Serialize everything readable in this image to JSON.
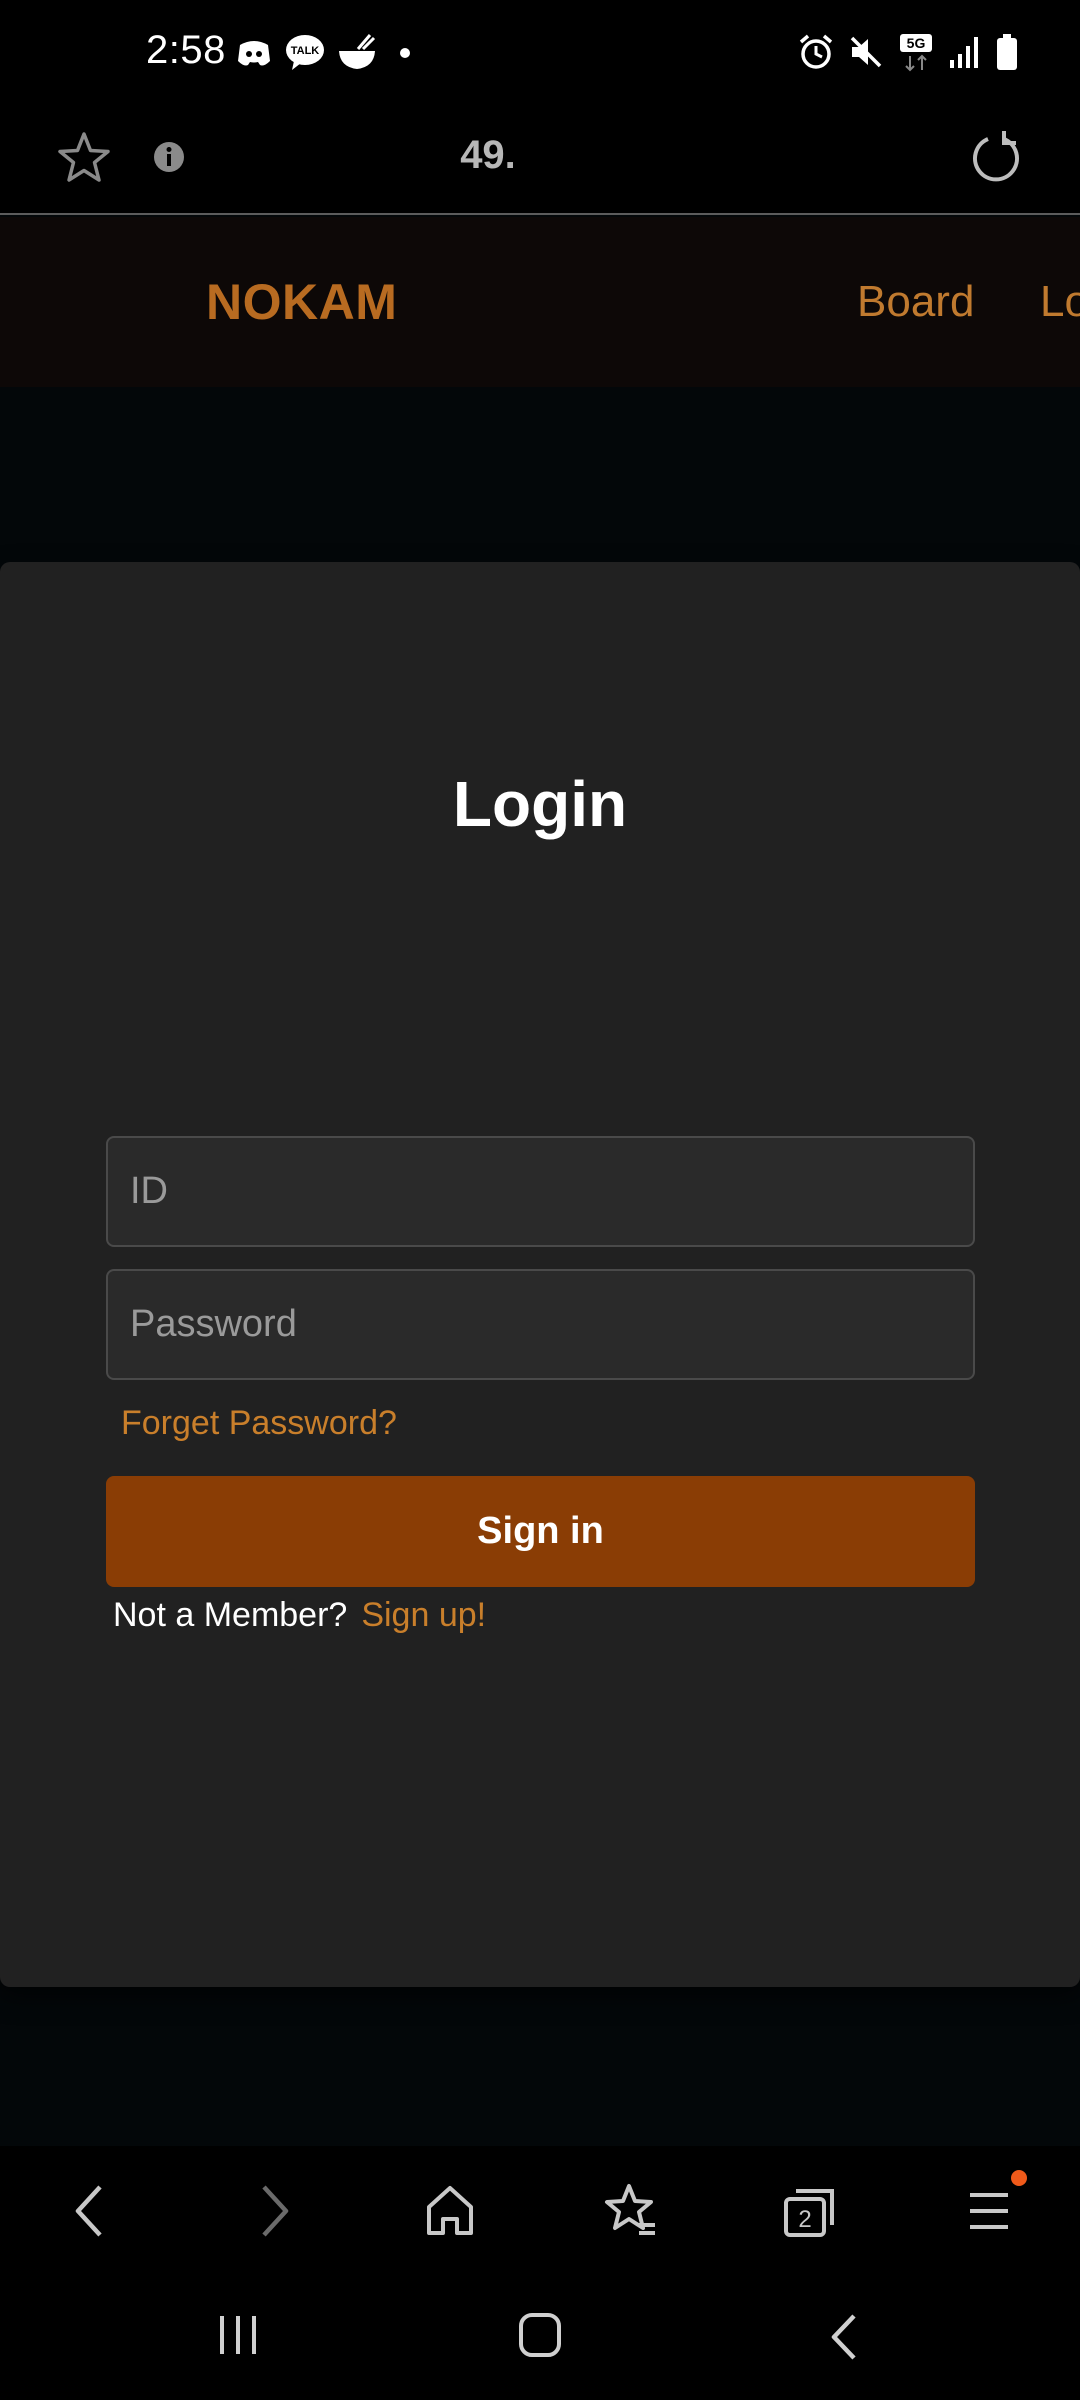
{
  "status_bar": {
    "time": "2:58",
    "left_icons": [
      "discord-icon",
      "kakaotalk-icon",
      "food-delivery-icon",
      "notification-dot"
    ],
    "right_icons": [
      "alarm-icon",
      "mute-icon",
      "5g-icon",
      "signal-icon",
      "battery-icon"
    ]
  },
  "browser": {
    "url": "49.",
    "icons": [
      "star-icon",
      "info-icon",
      "reload-icon"
    ]
  },
  "site_nav": {
    "brand": "NOKAM",
    "links": [
      {
        "label": "Board"
      },
      {
        "label": "Lo"
      }
    ]
  },
  "login": {
    "title": "Login",
    "id_placeholder": "ID",
    "password_placeholder": "Password",
    "forgot_label": "Forget Password?",
    "signin_label": "Sign in",
    "member_prompt": "Not a Member?",
    "signup_label": "Sign up!"
  },
  "browser_bottom": {
    "tab_count": "2",
    "icons": [
      "back-icon",
      "forward-icon",
      "home-icon",
      "bookmarks-icon",
      "tabs-icon",
      "menu-icon"
    ]
  },
  "android_nav": {
    "icons": [
      "recents-icon",
      "home-icon",
      "back-icon"
    ]
  },
  "colors": {
    "accent": "#c07a2f",
    "brand": "#b86b21",
    "button": "#8a3d05",
    "card": "#212121",
    "background": "#030709"
  }
}
